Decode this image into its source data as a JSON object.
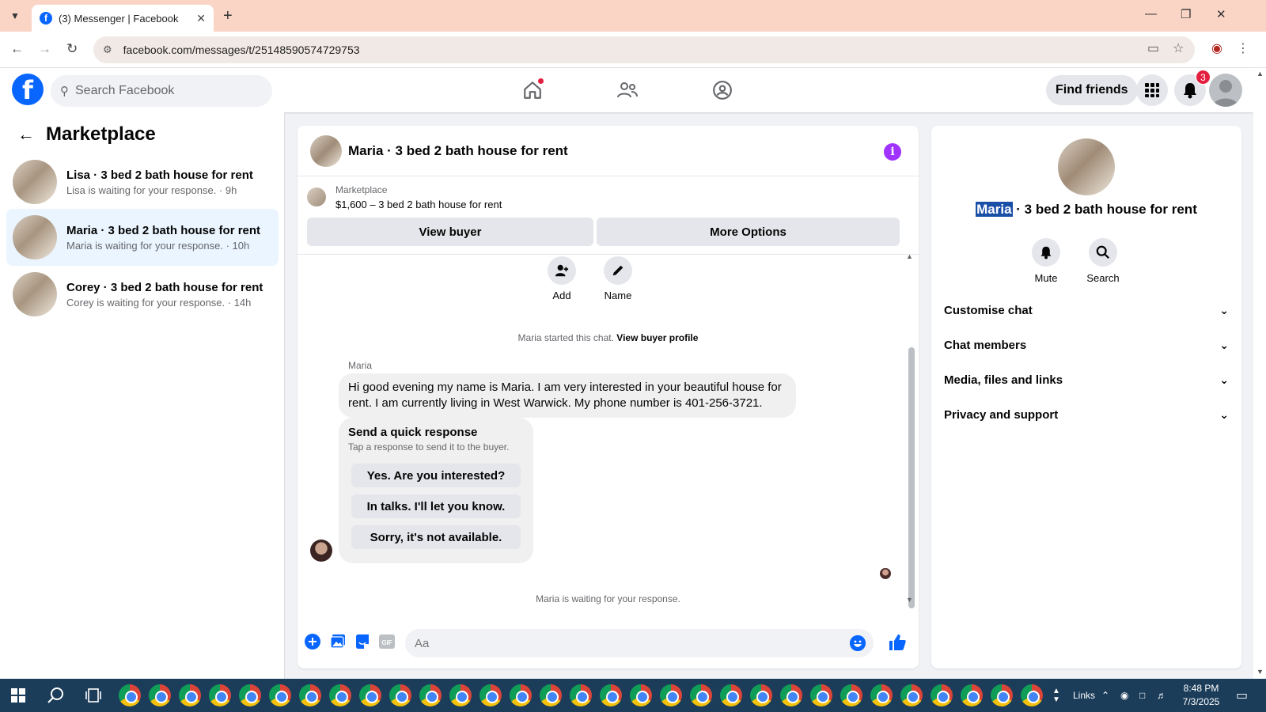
{
  "browser": {
    "tab_title": "(3) Messenger | Facebook",
    "url": "facebook.com/messages/t/25148590574729753"
  },
  "fb_header": {
    "search_placeholder": "Search Facebook",
    "find_friends": "Find friends",
    "notification_count": "3"
  },
  "sidebar": {
    "title": "Marketplace",
    "conversations": [
      {
        "name": "Lisa · 3 bed 2 bath house for rent",
        "status": "Lisa is waiting for your response. · 9h"
      },
      {
        "name": "Maria · 3 bed 2 bath house for rent",
        "status": "Maria is waiting for your response. · 10h"
      },
      {
        "name": "Corey · 3 bed 2 bath house for rent",
        "status": "Corey is waiting for your response. · 14h"
      }
    ]
  },
  "chat": {
    "title": "Maria · 3 bed 2 bath house for rent",
    "marketplace_label": "Marketplace",
    "listing": "$1,600 – 3 bed 2 bath house for rent",
    "view_buyer": "View buyer",
    "more_options": "More Options",
    "add_label": "Add",
    "name_label": "Name",
    "started_text": "Maria started this chat.",
    "view_buyer_profile": "View buyer profile",
    "sender": "Maria",
    "message": "Hi good evening my name is Maria. I am very interested in your beautiful house for rent. I am currently living in West Warwick. My phone number is 401-256-3721.",
    "quick_title": "Send a quick response",
    "quick_sub": "Tap a response to send it to the buyer.",
    "quick_responses": [
      "Yes. Are you interested?",
      "In talks. I'll let you know.",
      "Sorry, it's not available."
    ],
    "waiting": "Maria is waiting for your response.",
    "input_placeholder": "Aa"
  },
  "info_panel": {
    "name_highlight": "Maria",
    "title_rest": " · 3 bed 2 bath house for rent",
    "mute": "Mute",
    "search": "Search",
    "sections": [
      "Customise chat",
      "Chat members",
      "Media, files and links",
      "Privacy and support"
    ]
  },
  "taskbar": {
    "links": "Links",
    "time": "8:48 PM",
    "date": "7/3/2025"
  },
  "colors": {
    "brand_blue": "#0866ff",
    "info_purple": "#a033ff",
    "badge_red": "#e41e3f",
    "tab_bar": "#fad5c6",
    "taskbar": "#1c3d5a"
  }
}
